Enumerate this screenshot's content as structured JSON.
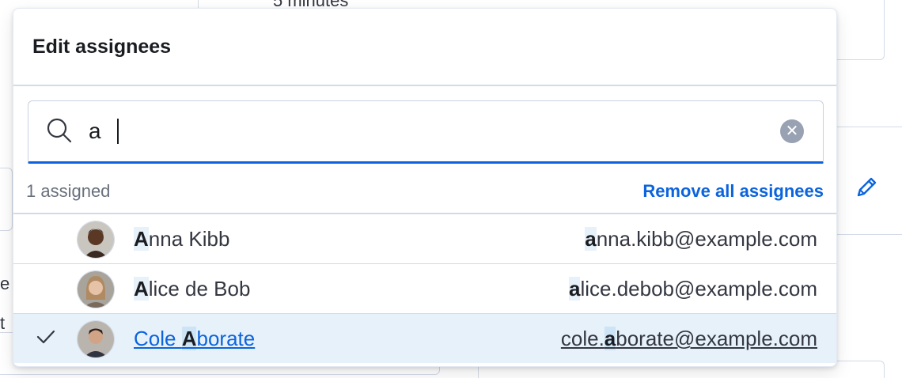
{
  "background": {
    "partial_text_top": "5 minutes",
    "partial_text_left_1": "e",
    "partial_text_left_2": "t"
  },
  "popover": {
    "title": "Edit assignees",
    "search": {
      "value": "a",
      "placeholder": ""
    },
    "assigned_count": "1 assigned",
    "remove_all_label": "Remove all assignees",
    "users": [
      {
        "name_match": "A",
        "name_rest": "nna Kibb",
        "email_prefix": "",
        "email_match": "a",
        "email_rest": "nna.kibb@example.com",
        "selected": false
      },
      {
        "name_match": "A",
        "name_rest": "lice de Bob",
        "email_prefix": "",
        "email_match": "a",
        "email_rest": "lice.debob@example.com",
        "selected": false
      },
      {
        "name_prefix": "Cole ",
        "name_match": "A",
        "name_rest": "borate",
        "email_prefix": "cole.",
        "email_match": "a",
        "email_rest": "borate@example.com",
        "selected": true
      }
    ]
  },
  "icons": {
    "search": "search-icon",
    "clear": "clear-icon",
    "check": "check-icon",
    "edit": "pencil-icon"
  },
  "colors": {
    "accent": "#0b64dd",
    "selected_row": "#e6f1fa",
    "muted_text": "#69707d",
    "border": "#d3dae6"
  }
}
